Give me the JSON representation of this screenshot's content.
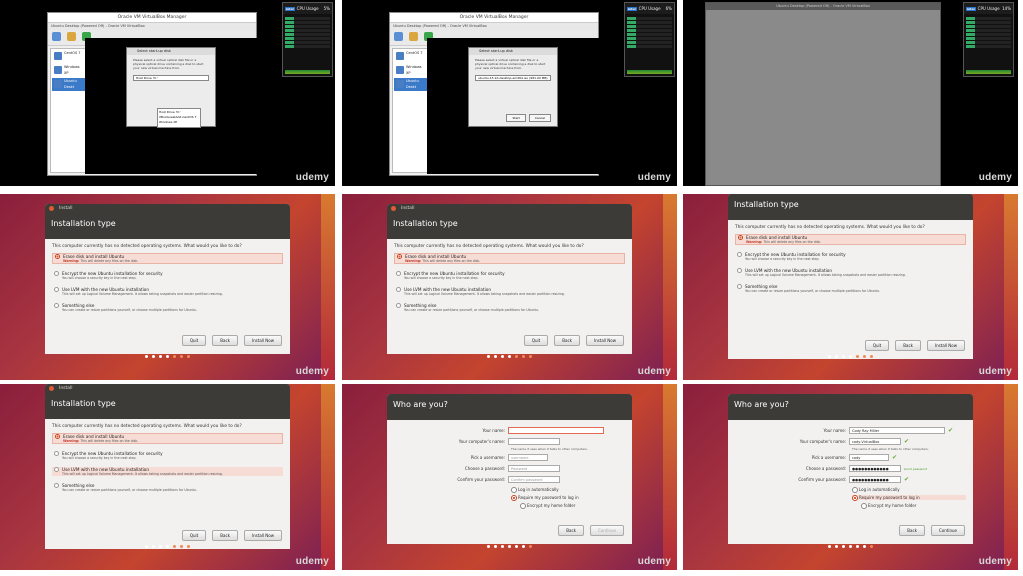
{
  "watermark": "udemy",
  "vbox": {
    "title": "Oracle VM VirtualBox Manager",
    "subtitle": "Ubuntu Desktop (Powered Off) - Oracle VM VirtualBox",
    "vms": [
      "CentOS 7",
      "Windows XP",
      "Ubuntu Deskt"
    ],
    "tools": [
      "New",
      "Settings",
      "Start"
    ],
    "dialog_title": "Select start-up disk",
    "dialog_text": "Please select a virtual optical disk file or a physical optical drive containing a disk to start your new virtual machine from.",
    "selected_disk": "Host Drive 'D:'",
    "selected_disk2": "ubuntu-15.10-desktop-amd64.iso (981.00 MB)",
    "dropdown": [
      "Host Drive 'D:'",
      "VBoxGuestAdd-CentOS 7",
      "Windows XP"
    ],
    "start_label": "Start",
    "cancel_label": "Cancel",
    "cpu_title": "CPU Usage",
    "cpu_a": "5%",
    "cpu_b": "6%",
    "cpu_c": "14%"
  },
  "install": {
    "window_title": "Install",
    "heading": "Installation type",
    "question": "This computer currently has no detected operating systems. What would you like to do?",
    "options": [
      {
        "label": "Erase disk and install Ubuntu",
        "desc_warn": "Warning:",
        "desc": "This will delete any files on the disk."
      },
      {
        "label": "Encrypt the new Ubuntu installation for security",
        "desc": "You will choose a security key in the next step."
      },
      {
        "label": "Use LVM with the new Ubuntu installation",
        "desc": "This will set up Logical Volume Management. It allows taking snapshots and easier partition resizing."
      },
      {
        "label": "Something else",
        "desc": "You can create or resize partitions yourself, or choose multiple partitions for Ubuntu."
      }
    ],
    "quit": "Quit",
    "back": "Back",
    "install_now": "Install Now"
  },
  "who": {
    "heading": "Who are you?",
    "name_label": "Your name:",
    "computer_label": "Your computer's name:",
    "computer_note": "The name it uses when it talks to other computers.",
    "user_label": "Pick a username:",
    "pass_label": "Choose a password:",
    "confirm_label": "Confirm your password:",
    "ph_user": "username",
    "ph_pass": "Password",
    "ph_confirm": "Confirm password",
    "name_val": "Cody Ray Miller",
    "computer_val": "cody-VirtualBox",
    "user_val": "cody",
    "pass_val": "●●●●●●●●●●●●",
    "good": "Good password",
    "login_auto": "Log in automatically",
    "require_pw": "Require my password to log in",
    "encrypt_home": "Encrypt my home folder",
    "back": "Back",
    "continue": "Continue"
  }
}
